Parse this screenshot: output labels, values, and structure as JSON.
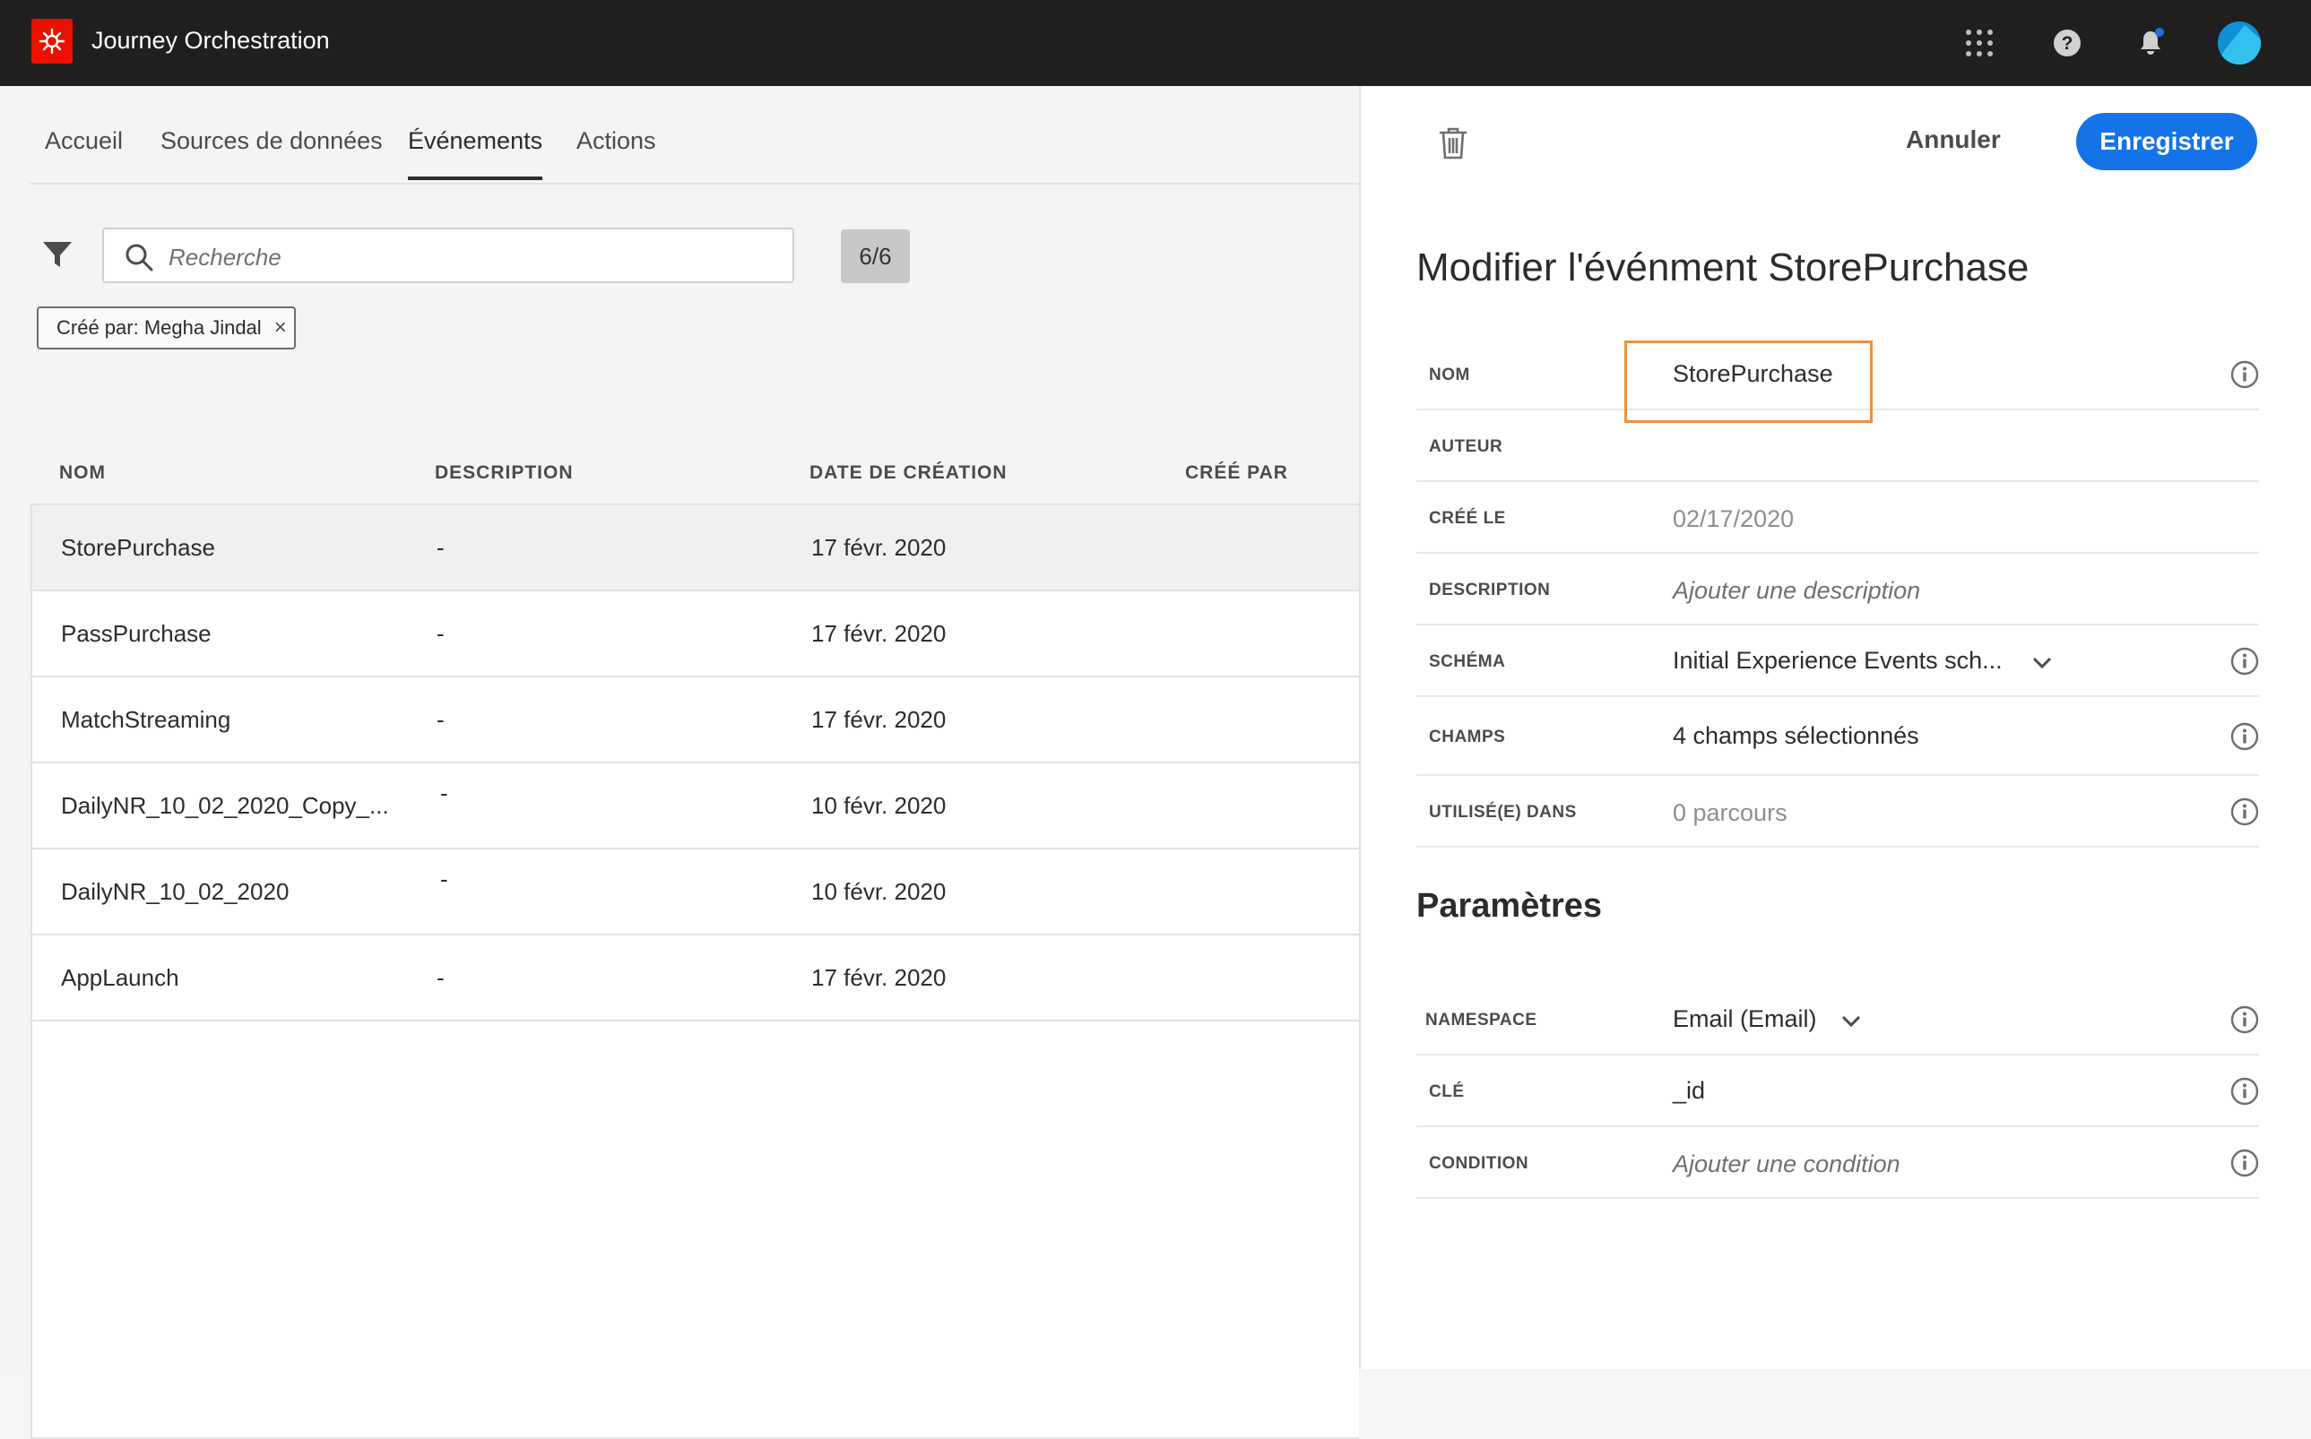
{
  "app": {
    "title": "Journey Orchestration"
  },
  "tabs": [
    "Accueil",
    "Sources de données",
    "Événements",
    "Actions"
  ],
  "active_tab": "Événements",
  "search": {
    "placeholder": "Recherche"
  },
  "counter": "6/6",
  "filter_chip": {
    "label": "Créé par: Megha Jindal",
    "close": "×"
  },
  "table": {
    "headers": [
      "NOM",
      "DESCRIPTION",
      "DATE DE CRÉATION",
      "CRÉÉ PAR"
    ],
    "rows": [
      {
        "name": "StorePurchase",
        "description": "-",
        "date": "17 févr. 2020",
        "created_by": ""
      },
      {
        "name": "PassPurchase",
        "description": "-",
        "date": "17 févr. 2020",
        "created_by": ""
      },
      {
        "name": "MatchStreaming",
        "description": "-",
        "date": "17 févr. 2020",
        "created_by": ""
      },
      {
        "name": "DailyNR_10_02_2020_Copy_...",
        "description": "-",
        "date": "10 févr. 2020",
        "created_by": ""
      },
      {
        "name": "DailyNR_10_02_2020",
        "description": "-",
        "date": "10 févr. 2020",
        "created_by": ""
      },
      {
        "name": "AppLaunch",
        "description": "-",
        "date": "17 févr. 2020",
        "created_by": ""
      }
    ]
  },
  "panel": {
    "cancel_label": "Annuler",
    "save_label": "Enregistrer",
    "title": "Modifier l'événment StorePurchase",
    "fields": {
      "nom": {
        "label": "NOM",
        "value": "StorePurchase"
      },
      "auteur": {
        "label": "AUTEUR",
        "value": ""
      },
      "cree_le": {
        "label": "CRÉÉ LE",
        "value": "02/17/2020"
      },
      "description": {
        "label": "DESCRIPTION",
        "placeholder": "Ajouter une description"
      },
      "schema": {
        "label": "SCHÉMA",
        "value": "Initial Experience Events sch..."
      },
      "champs": {
        "label": "CHAMPS",
        "value": "4 champs sélectionnés"
      },
      "utilise_dans": {
        "label": "UTILISÉ(E) DANS",
        "value": "0 parcours"
      }
    },
    "parameters_title": "Paramètres",
    "parameters": {
      "namespace": {
        "label": "NAMESPACE",
        "value": "Email (Email)"
      },
      "cle": {
        "label": "CLÉ",
        "value": "_id"
      },
      "condition": {
        "label": "CONDITION",
        "placeholder": "Ajouter une condition"
      }
    }
  },
  "colors": {
    "topbar": "#1f1f1f",
    "brand": "#eb1000",
    "primary": "#1473e6",
    "highlight": "#f0913c",
    "notification_dot": "#1473e6"
  },
  "icons": [
    "adobe-logo-icon",
    "apps-grid-icon",
    "help-icon",
    "bell-icon",
    "avatar",
    "filter-icon",
    "search-icon",
    "trash-icon",
    "info-icon",
    "chevron-down-icon"
  ]
}
